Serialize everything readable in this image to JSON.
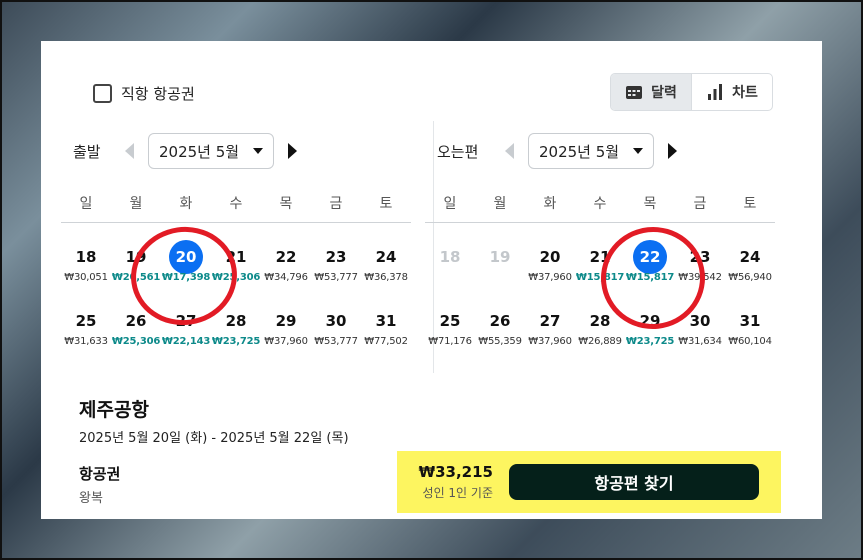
{
  "filters": {
    "direct_only_label": "직항 항공권",
    "direct_only_checked": false
  },
  "view_toggle": {
    "calendar_label": "달력",
    "chart_label": "차트",
    "active": "달력"
  },
  "weekdays": [
    "일",
    "월",
    "화",
    "수",
    "목",
    "금",
    "토"
  ],
  "departure": {
    "label": "출발",
    "month": "2025년 5월",
    "weeks": [
      [
        {
          "day": "18",
          "price": "₩30,051",
          "low": false
        },
        {
          "day": "19",
          "price": "₩20,561",
          "low": true
        },
        {
          "day": "20",
          "price": "₩17,398",
          "low": true,
          "selected": true
        },
        {
          "day": "21",
          "price": "₩25,306",
          "low": true
        },
        {
          "day": "22",
          "price": "₩34,796",
          "low": false
        },
        {
          "day": "23",
          "price": "₩53,777",
          "low": false
        },
        {
          "day": "24",
          "price": "₩36,378",
          "low": false
        }
      ],
      [
        {
          "day": "25",
          "price": "₩31,633",
          "low": false
        },
        {
          "day": "26",
          "price": "₩25,306",
          "low": true
        },
        {
          "day": "27",
          "price": "₩22,143",
          "low": true
        },
        {
          "day": "28",
          "price": "₩23,725",
          "low": true
        },
        {
          "day": "29",
          "price": "₩37,960",
          "low": false
        },
        {
          "day": "30",
          "price": "₩53,777",
          "low": false
        },
        {
          "day": "31",
          "price": "₩77,502",
          "low": false
        }
      ]
    ]
  },
  "return": {
    "label": "오는편",
    "month": "2025년 5월",
    "weeks": [
      [
        {
          "day": "18",
          "price": "",
          "low": false,
          "muted": true
        },
        {
          "day": "19",
          "price": "",
          "low": false,
          "muted": true
        },
        {
          "day": "20",
          "price": "₩37,960",
          "low": false
        },
        {
          "day": "21",
          "price": "₩15,817",
          "low": true
        },
        {
          "day": "22",
          "price": "₩15,817",
          "low": true,
          "selected": true
        },
        {
          "day": "23",
          "price": "₩39,542",
          "low": false
        },
        {
          "day": "24",
          "price": "₩56,940",
          "low": false
        }
      ],
      [
        {
          "day": "25",
          "price": "₩71,176",
          "low": false
        },
        {
          "day": "26",
          "price": "₩55,359",
          "low": false
        },
        {
          "day": "27",
          "price": "₩37,960",
          "low": false
        },
        {
          "day": "28",
          "price": "₩26,889",
          "low": false
        },
        {
          "day": "29",
          "price": "₩23,725",
          "low": true
        },
        {
          "day": "30",
          "price": "₩31,634",
          "low": false
        },
        {
          "day": "31",
          "price": "₩60,104",
          "low": false
        }
      ]
    ]
  },
  "summary": {
    "airport": "제주공항",
    "date_range": "2025년 5월 20일 (화) - 2025년 5월 22일 (목)",
    "ticket_label": "항공권",
    "trip_type": "왕복",
    "total_price": "₩33,215",
    "per_label": "성인 1인 기준",
    "search_button": "항공편 찾기"
  },
  "colors": {
    "selected": "#0b6ff2",
    "low_price": "#0d8a8a",
    "cta_bg": "#fdf560",
    "button": "#05201a",
    "annotation": "#e21b25"
  }
}
